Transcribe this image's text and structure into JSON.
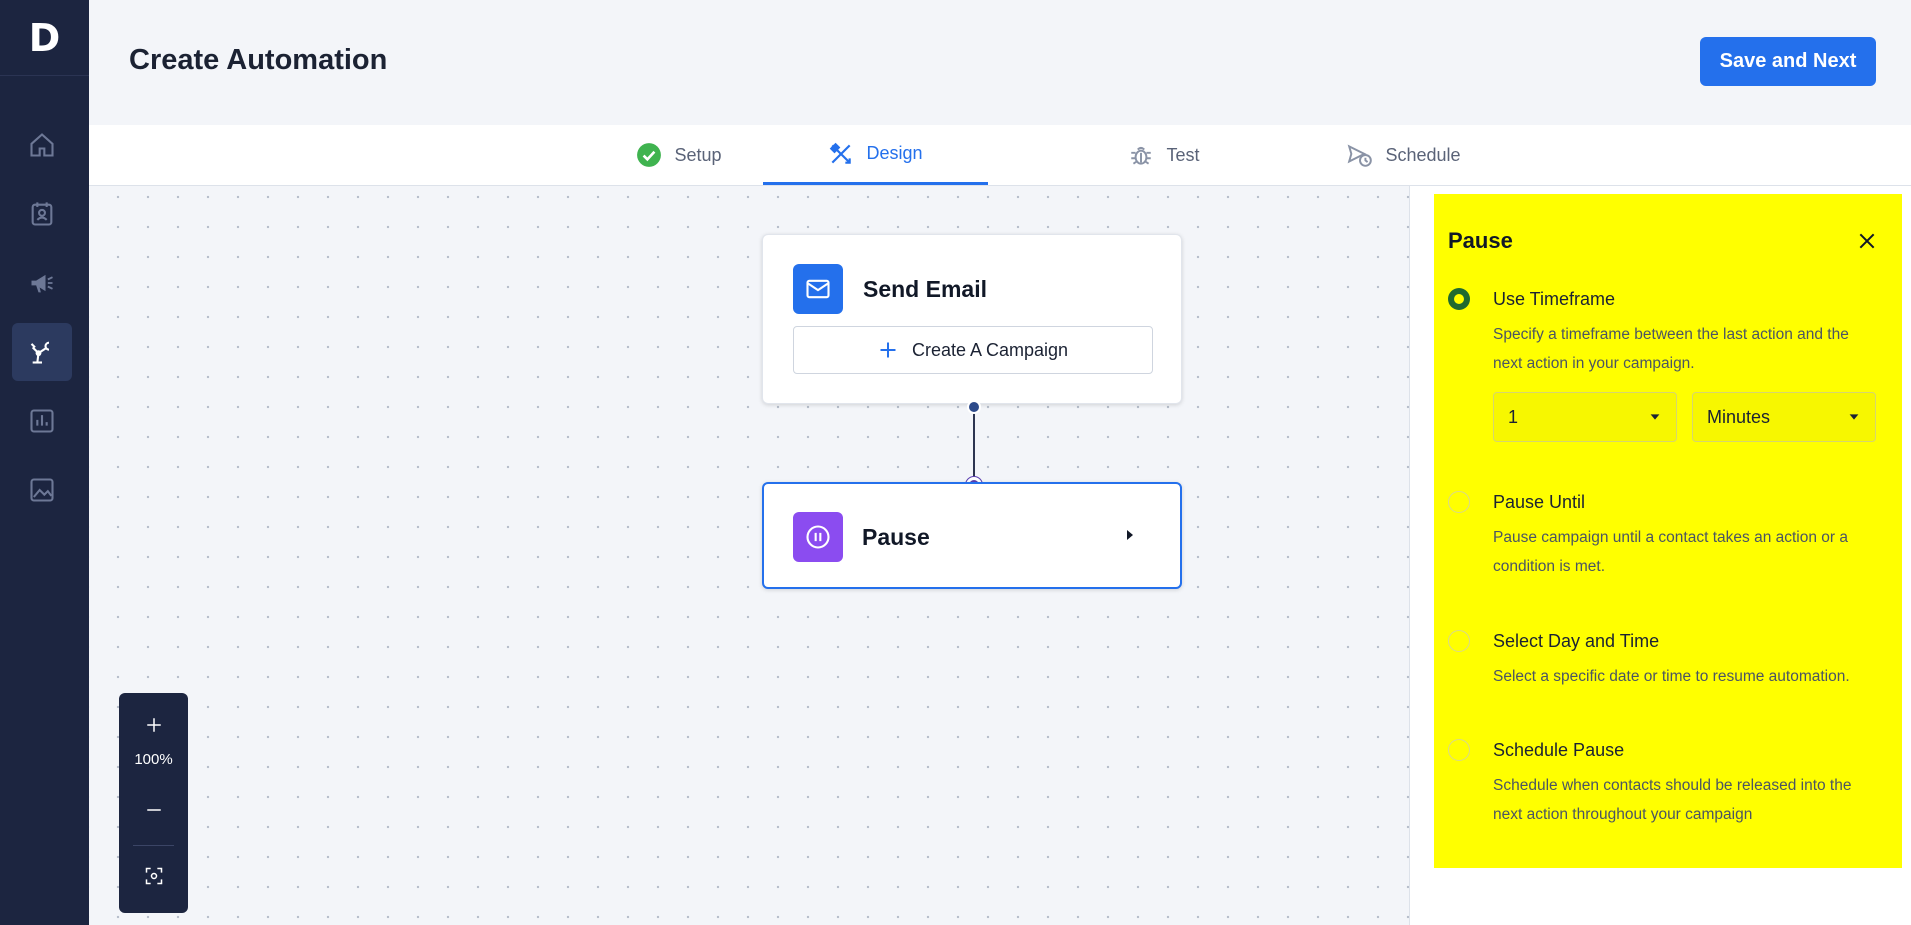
{
  "app": {
    "logo_letter": "D"
  },
  "sidebar": {
    "items": [
      {
        "name": "home-icon"
      },
      {
        "name": "contacts-icon"
      },
      {
        "name": "megaphone-icon"
      },
      {
        "name": "automation-icon"
      },
      {
        "name": "reports-icon"
      },
      {
        "name": "image-icon"
      }
    ]
  },
  "header": {
    "title": "Create Automation",
    "save_label": "Save and Next"
  },
  "tabs": [
    {
      "label": "Setup",
      "icon": "check-circle-icon",
      "state": "done"
    },
    {
      "label": "Design",
      "icon": "design-tools-icon",
      "state": "active"
    },
    {
      "label": "Test",
      "icon": "bug-icon",
      "state": "default"
    },
    {
      "label": "Schedule",
      "icon": "schedule-send-icon",
      "state": "default"
    }
  ],
  "canvas": {
    "email_node": {
      "title": "Send Email",
      "button_label": "Create A Campaign"
    },
    "pause_node": {
      "title": "Pause"
    },
    "zoom": {
      "level": "100%"
    }
  },
  "pause_panel": {
    "title": "Pause",
    "options": [
      {
        "label": "Use Timeframe",
        "description": "Specify a timeframe between the last action and the next action in your campaign.",
        "selected": true
      },
      {
        "label": "Pause Until",
        "description": "Pause campaign until a contact takes an action or a condition is met.",
        "selected": false
      },
      {
        "label": "Select Day and Time",
        "description": "Select a specific date or time to resume automation.",
        "selected": false
      },
      {
        "label": "Schedule Pause",
        "description": "Schedule when contacts should be released into the next action throughout your campaign",
        "selected": false
      }
    ],
    "timeframe": {
      "amount": "1",
      "unit": "Minutes"
    }
  },
  "colors": {
    "accent": "#2470ec",
    "sidebar": "#1c2540",
    "highlight": "#ffff00",
    "success": "#3fb34f",
    "pause_icon_bg": "#8b4cf0"
  }
}
